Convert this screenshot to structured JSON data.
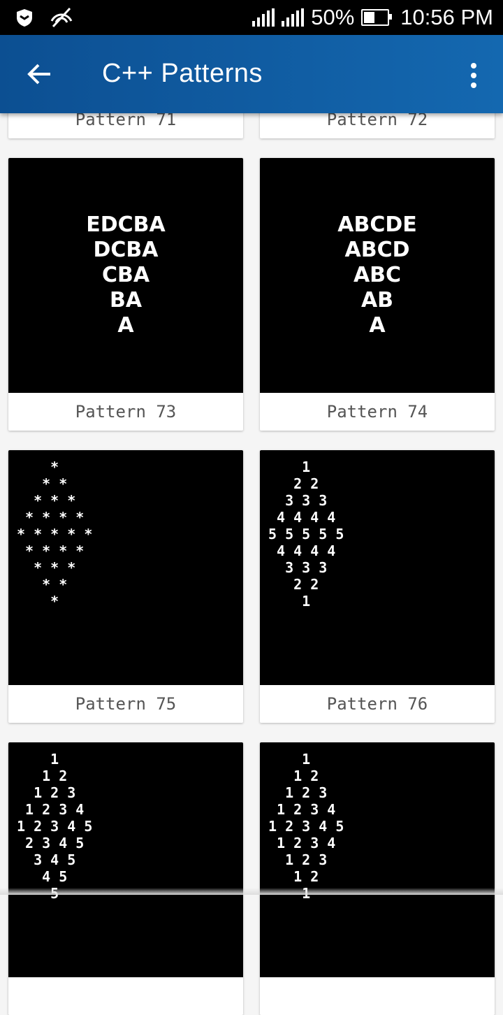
{
  "status_bar": {
    "battery_percent_text": "50%",
    "time": "10:56 PM",
    "battery_level": 0.5,
    "icons": [
      "shield-icon",
      "no-location-icon",
      "signal-icon",
      "signal-icon",
      "battery-icon"
    ]
  },
  "app_bar": {
    "title": "C++ Patterns",
    "back_icon": "arrow-back-icon",
    "menu_icon": "more-vert-icon",
    "color": "#0f5aa0"
  },
  "cards": {
    "p71": {
      "label": "Pattern 71"
    },
    "p72": {
      "label": "Pattern 72"
    },
    "p73": {
      "label": "Pattern 73",
      "lines": [
        "EDCBA",
        "DCBA",
        "CBA",
        "BA",
        "A"
      ]
    },
    "p74": {
      "label": "Pattern 74",
      "lines": [
        "ABCDE",
        "ABCD",
        "ABC",
        "AB",
        "A"
      ]
    },
    "p75": {
      "label": "Pattern 75",
      "lines": [
        "    *",
        "   * *",
        "  * * *",
        " * * * *",
        "* * * * *",
        " * * * *",
        "  * * *",
        "   * *",
        "    *"
      ]
    },
    "p76": {
      "label": "Pattern 76",
      "lines": [
        "    1",
        "   2 2",
        "  3 3 3",
        " 4 4 4 4",
        "5 5 5 5 5",
        " 4 4 4 4",
        "  3 3 3",
        "   2 2",
        "    1"
      ]
    },
    "p77": {
      "lines": [
        "    1",
        "   1 2",
        "  1 2 3",
        " 1 2 3 4",
        "1 2 3 4 5",
        " 2 3 4 5",
        "  3 4 5",
        "   4 5",
        "    5"
      ]
    },
    "p78": {
      "lines": [
        "    1",
        "   1 2",
        "  1 2 3",
        " 1 2 3 4",
        "1 2 3 4 5",
        " 1 2 3 4",
        "  1 2 3",
        "   1 2",
        "    1"
      ]
    }
  }
}
